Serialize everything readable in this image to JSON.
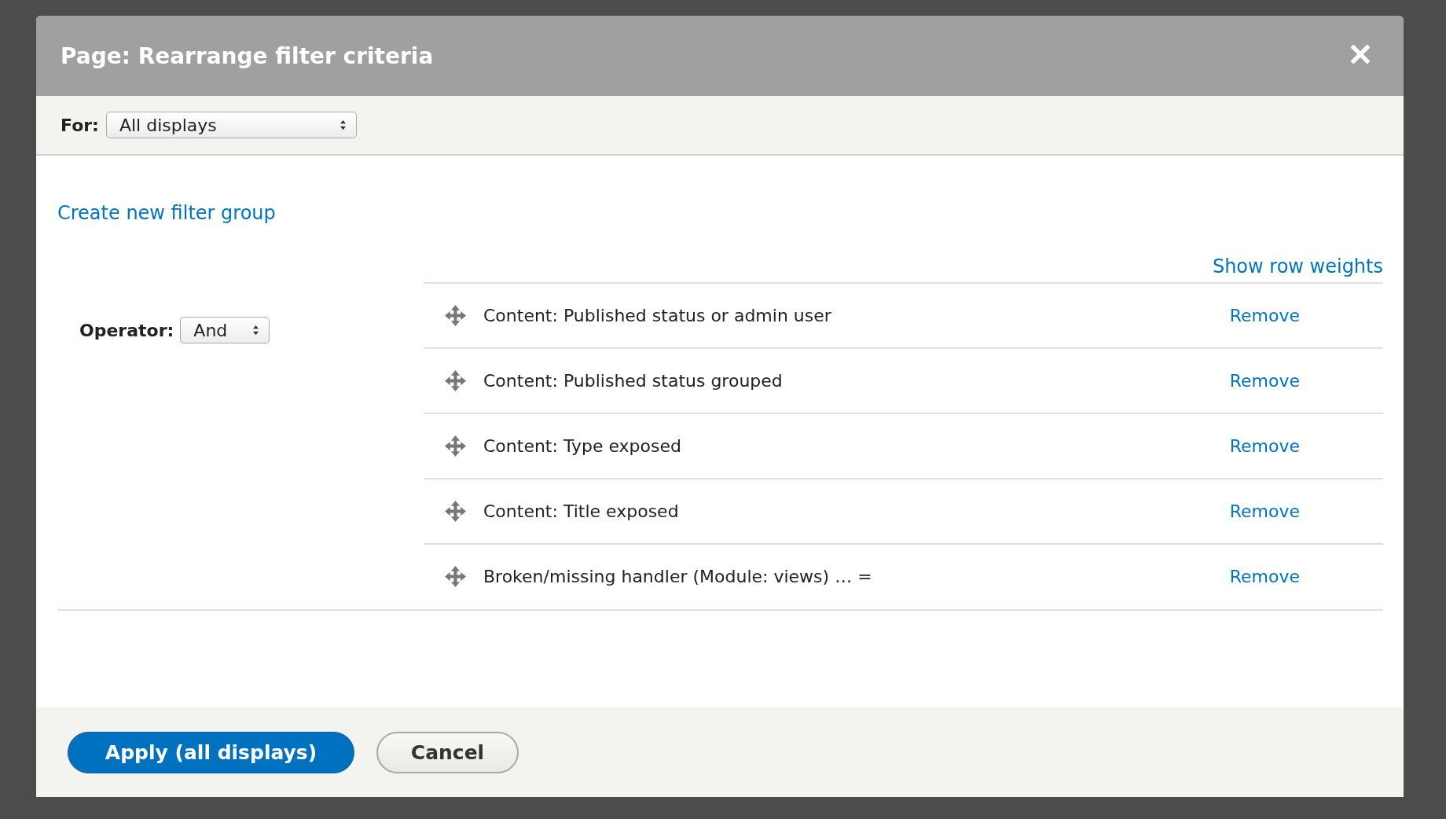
{
  "dialog": {
    "title": "Page: Rearrange filter criteria"
  },
  "for_bar": {
    "label": "For:",
    "select": "All displays"
  },
  "create_group_link": "Create new filter group",
  "show_weights_link": "Show row weights",
  "operator": {
    "label": "Operator:",
    "select": "And"
  },
  "filters": [
    {
      "label": "Content: Published status or admin user",
      "action": "Remove"
    },
    {
      "label": "Content: Published status grouped",
      "action": "Remove"
    },
    {
      "label": "Content: Type exposed",
      "action": "Remove"
    },
    {
      "label": "Content: Title exposed",
      "action": "Remove"
    },
    {
      "label": "Broken/missing handler (Module: views) … =",
      "action": "Remove"
    }
  ],
  "buttons": [
    {
      "label": "Apply (all displays)",
      "kind": "primary"
    },
    {
      "label": "Cancel",
      "kind": "secondary"
    }
  ]
}
